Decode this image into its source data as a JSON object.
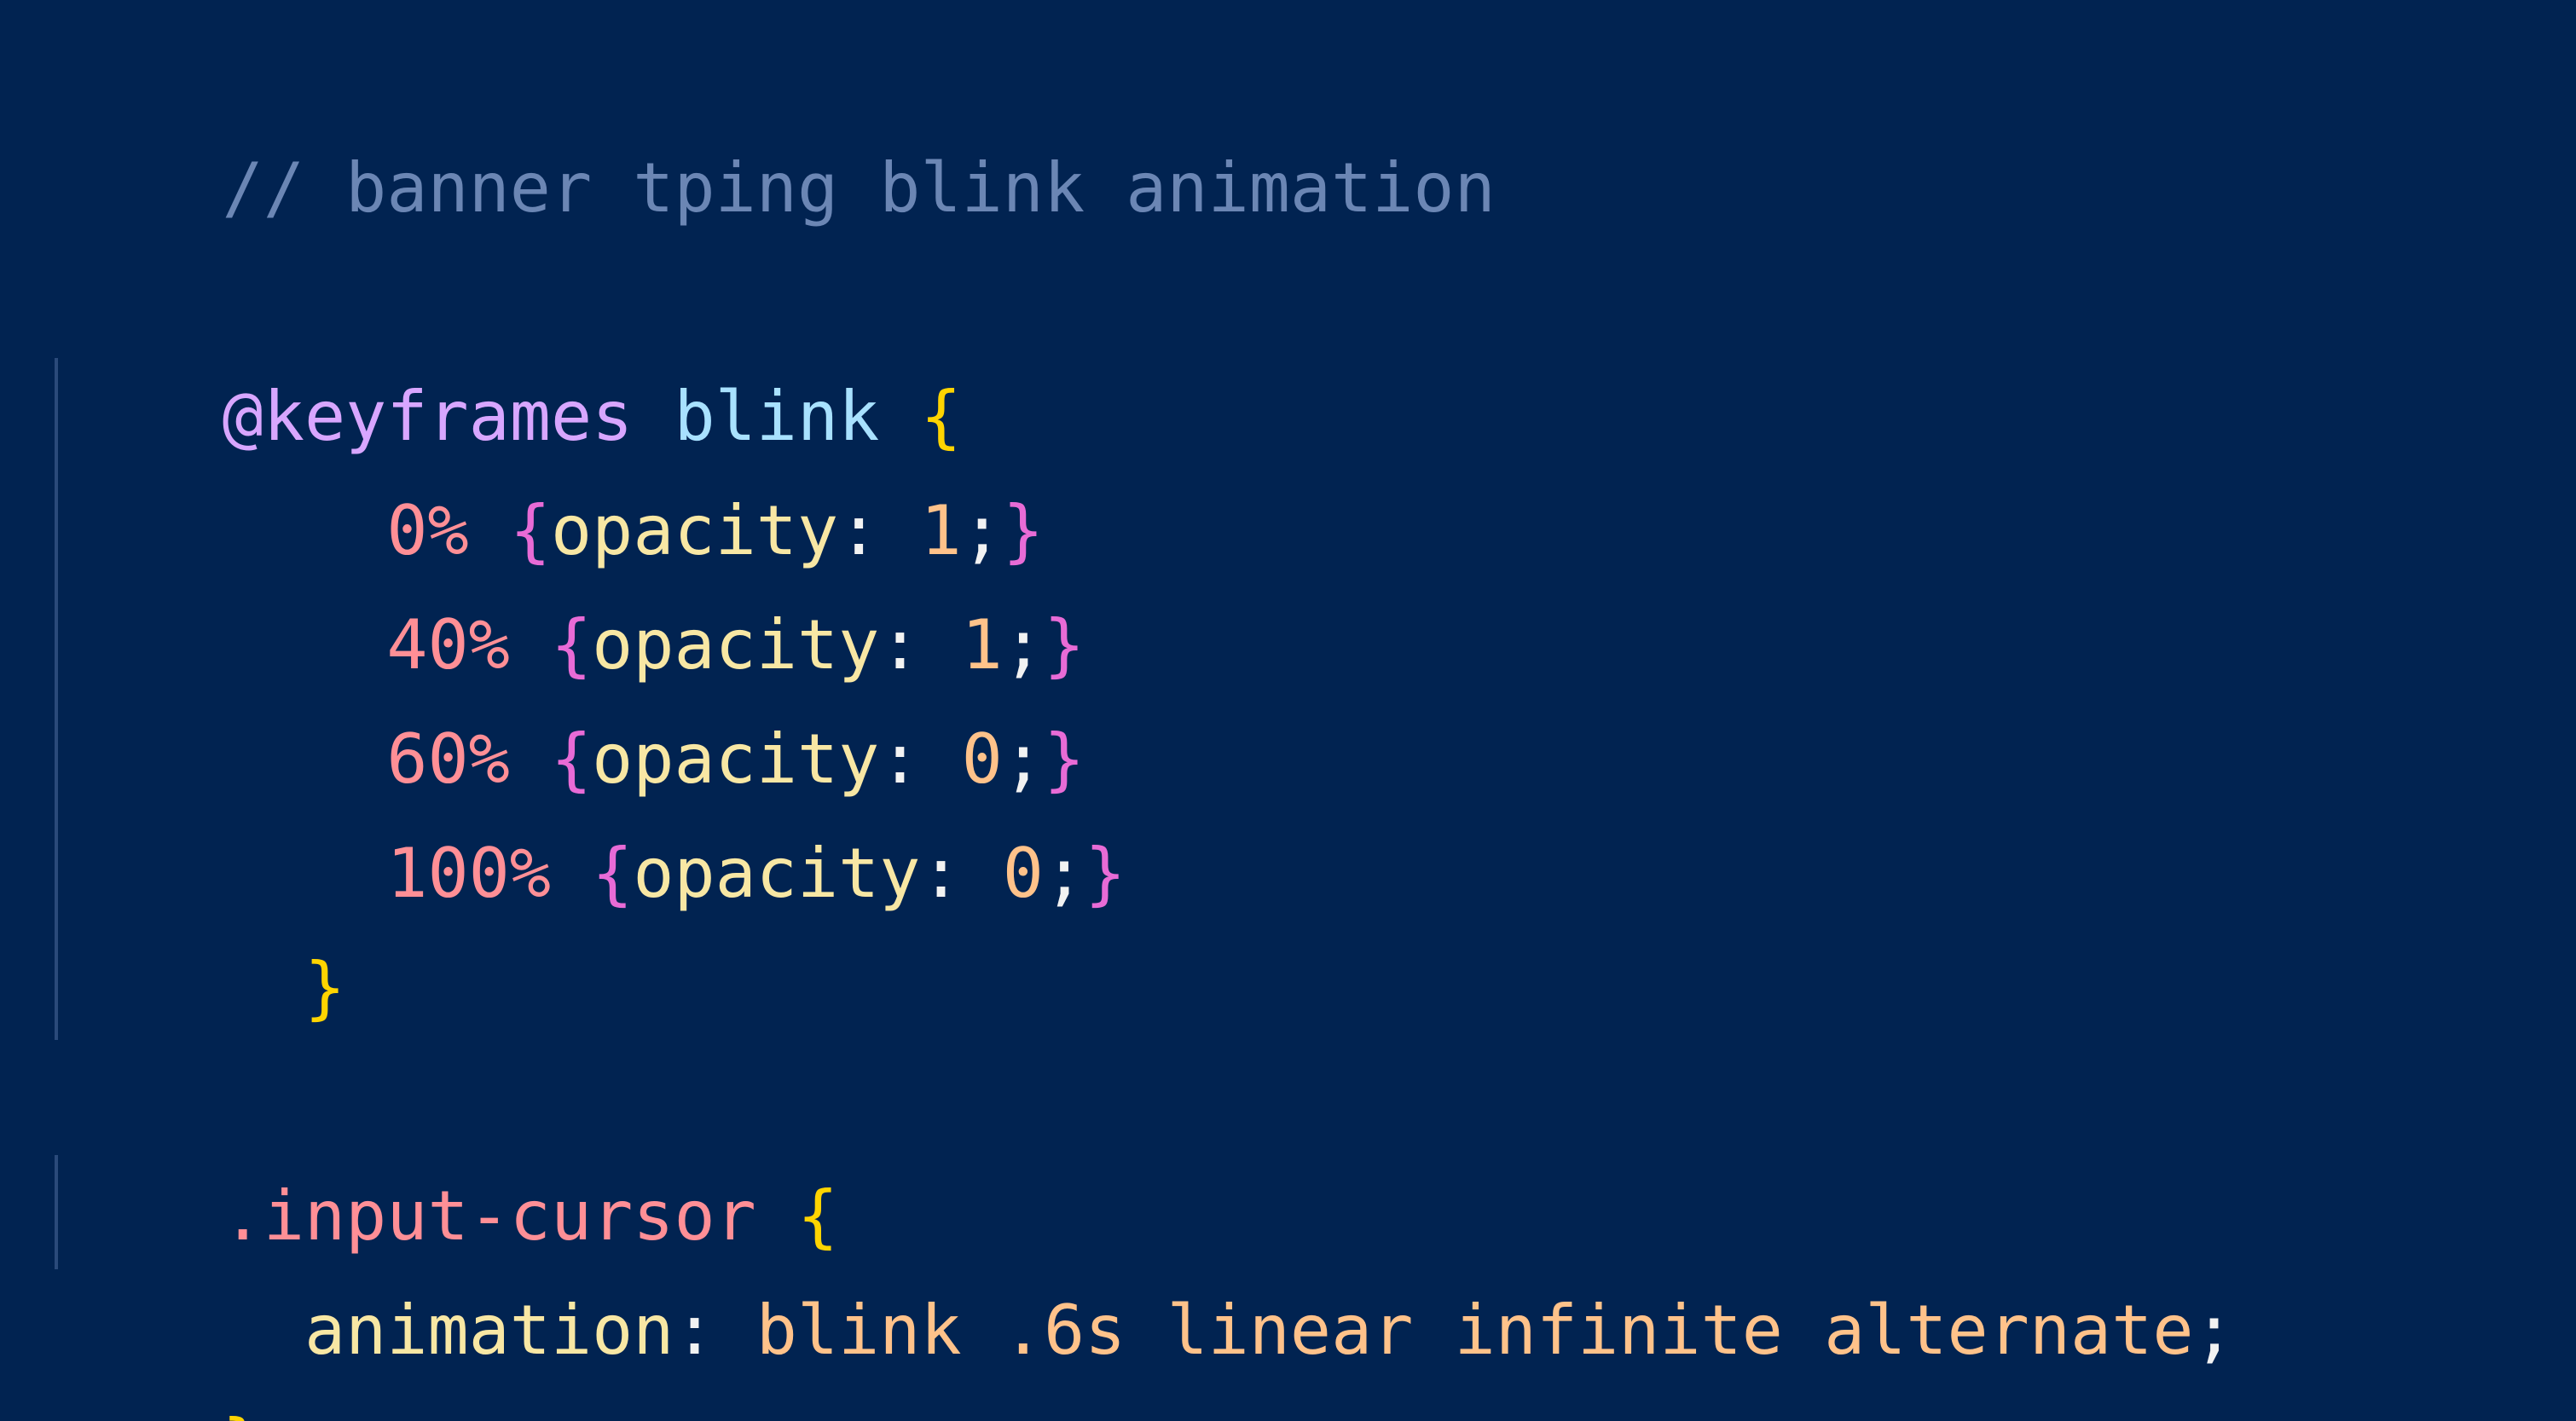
{
  "code": {
    "line1": {
      "comment": "// banner tping blink animation"
    },
    "line3": {
      "at": "@keyframes",
      "name": "blink",
      "open": "{"
    },
    "line4": {
      "indent": "    ",
      "selector": "0%",
      "brace_open": "{",
      "prop": "opacity",
      "colon": ": ",
      "value": "1",
      "semi": ";",
      "brace_close": "}"
    },
    "line5": {
      "indent": "    ",
      "selector": "40%",
      "brace_open": "{",
      "prop": "opacity",
      "colon": ": ",
      "value": "1",
      "semi": ";",
      "brace_close": "}"
    },
    "line6": {
      "indent": "    ",
      "selector": "60%",
      "brace_open": "{",
      "prop": "opacity",
      "colon": ": ",
      "value": "0",
      "semi": ";",
      "brace_close": "}"
    },
    "line7": {
      "indent": "    ",
      "selector": "100%",
      "brace_open": "{",
      "prop": "opacity",
      "colon": ": ",
      "value": "0",
      "semi": ";",
      "brace_close": "}"
    },
    "line8": {
      "indent": "  ",
      "close": "}"
    },
    "line10": {
      "selector": ".input-cursor",
      "open": "{"
    },
    "line11": {
      "indent": "  ",
      "prop": "animation",
      "colon": ": ",
      "value": "blink .6s linear infinite alternate",
      "semi": ";"
    },
    "line12": {
      "close": "}"
    }
  },
  "colors": {
    "background": "#012351",
    "comment": "#6b86b4",
    "at_rule": "#d8a6ff",
    "animation_name": "#a8e1ff",
    "brace_outer": "#ffd400",
    "brace_inner": "#e86bd6",
    "selector": "#ff8f96",
    "property": "#f8e7a4",
    "value": "#ffc28a"
  }
}
